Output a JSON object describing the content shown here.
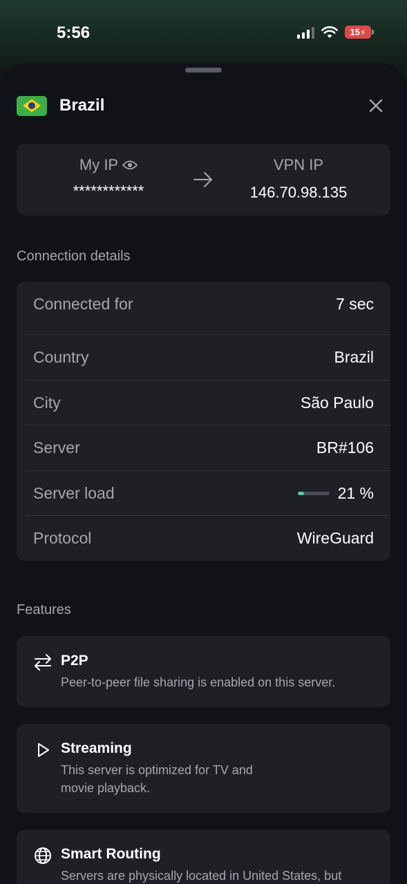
{
  "status_bar": {
    "time": "5:56",
    "battery": "15"
  },
  "header": {
    "country": "Brazil"
  },
  "ip_card": {
    "my_ip_label": "My IP",
    "my_ip_value": "************",
    "vpn_ip_label": "VPN IP",
    "vpn_ip_value": "146.70.98.135"
  },
  "connection": {
    "section_label": "Connection details",
    "rows": [
      {
        "label": "Connected for",
        "value": "7 sec"
      },
      {
        "label": "Country",
        "value": "Brazil"
      },
      {
        "label": "City",
        "value": "São Paulo"
      },
      {
        "label": "Server",
        "value": "BR#106"
      },
      {
        "label": "Server load",
        "value": "21 %",
        "load_fraction": 0.21
      },
      {
        "label": "Protocol",
        "value": "WireGuard"
      }
    ]
  },
  "features": {
    "section_label": "Features",
    "items": [
      {
        "icon": "p2p-arrows-icon",
        "title": "P2P",
        "desc": "Peer-to-peer file sharing is enabled on this server."
      },
      {
        "icon": "play-icon",
        "title": "Streaming",
        "desc_line1": "This server is optimized for TV and",
        "desc_line2": "movie playback."
      },
      {
        "icon": "globe-icon",
        "title": "Smart Routing",
        "desc": "Servers are physically located in United States, but"
      }
    ]
  },
  "colors": {
    "accent": "#4fd1a5",
    "card": "#1f2026",
    "sheet": "#111217",
    "battery": "#d94a4a"
  }
}
